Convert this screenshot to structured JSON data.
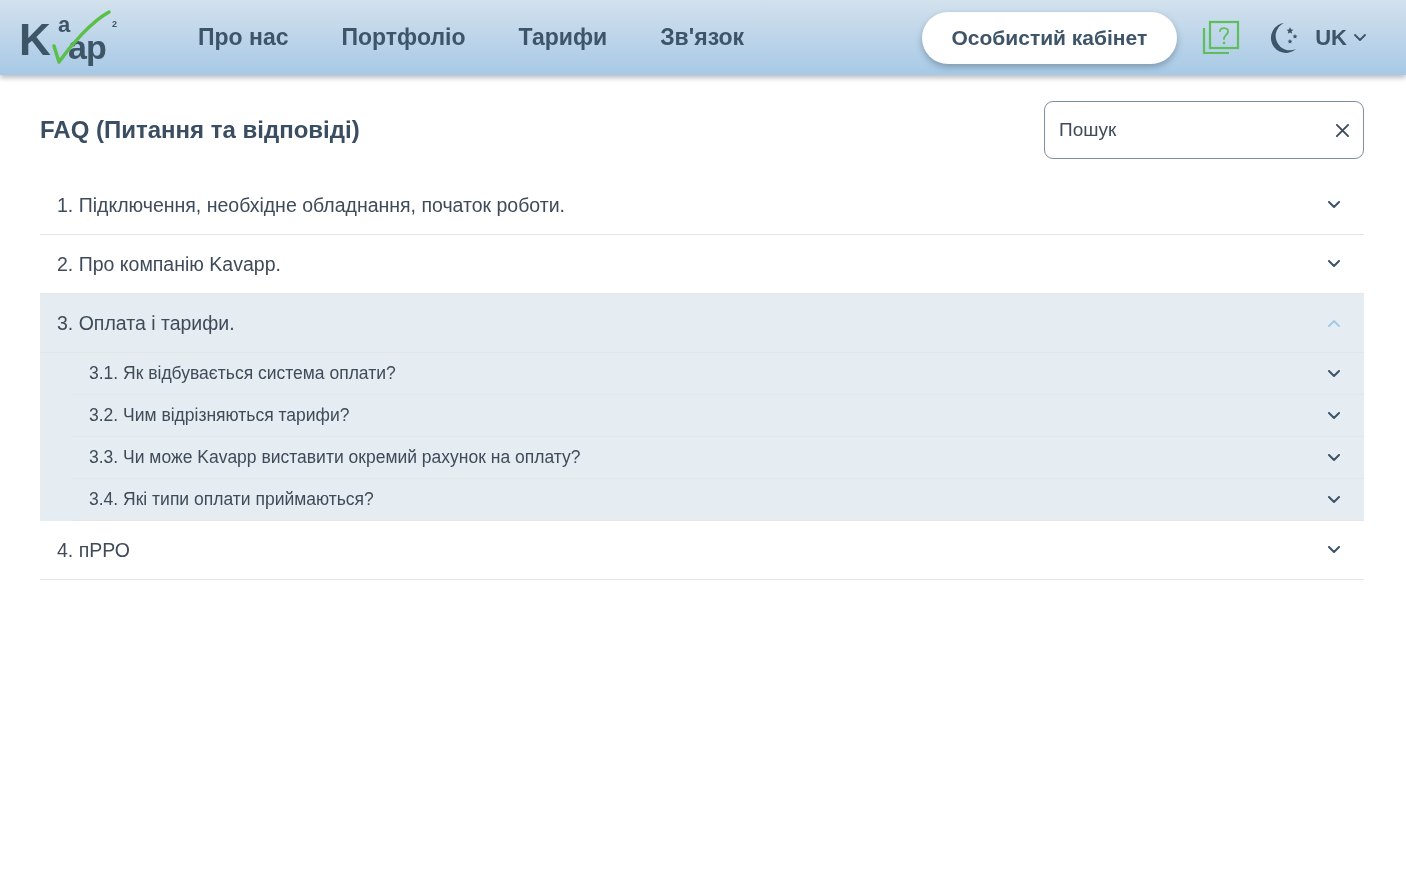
{
  "header": {
    "logo": {
      "initial": "K",
      "raised": "a",
      "rest": "ap",
      "superscript": "2"
    },
    "nav": [
      {
        "label": "Про нас"
      },
      {
        "label": "Портфоліо"
      },
      {
        "label": "Тарифи"
      },
      {
        "label": "Зв'язок"
      }
    ],
    "account_button": "Особистий кабінет",
    "language": "UK"
  },
  "page": {
    "title": "FAQ (Питання та відповіді)",
    "search": {
      "placeholder": "Пошук"
    }
  },
  "faq": [
    {
      "title": "1. Підключення, необхідне обладнання, початок роботи.",
      "expanded": false
    },
    {
      "title": "2. Про компанію Kavapp.",
      "expanded": false
    },
    {
      "title": "3. Оплата і тарифи.",
      "expanded": true,
      "children": [
        {
          "title": "3.1. Як відбувається система оплати?",
          "expanded": false
        },
        {
          "title": "3.2. Чим відрізняються тарифи?",
          "expanded": false
        },
        {
          "title": "3.3. Чи може Kavapp виставити окремий рахунок на оплату?",
          "expanded": false
        },
        {
          "title": "3.4. Які типи оплати приймаються?",
          "expanded": false
        }
      ]
    },
    {
      "title": "4. пРРО",
      "expanded": false
    }
  ]
}
